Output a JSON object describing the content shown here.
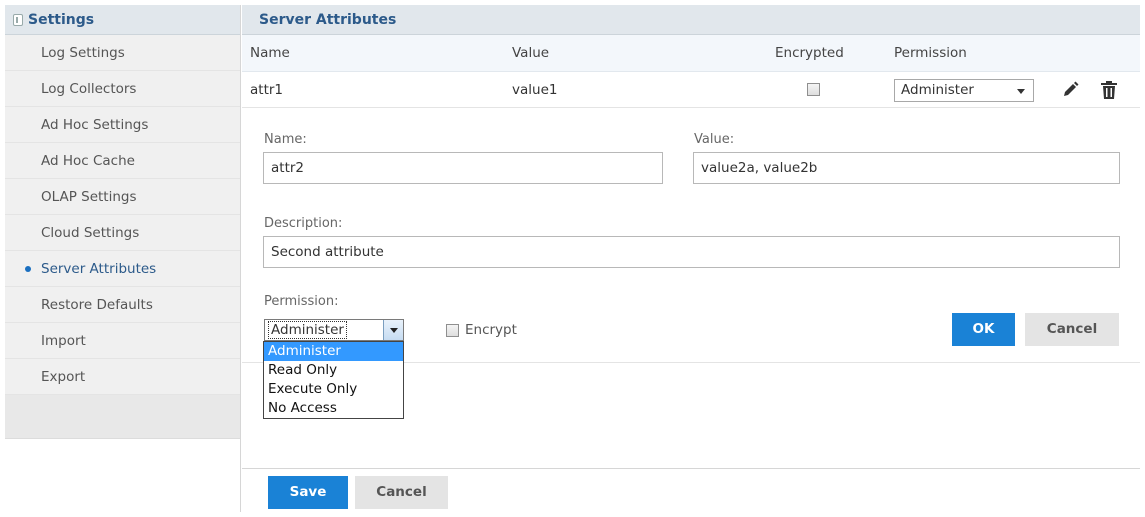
{
  "sidebar": {
    "title": "Settings",
    "items": [
      {
        "label": "Log Settings"
      },
      {
        "label": "Log Collectors"
      },
      {
        "label": "Ad Hoc Settings"
      },
      {
        "label": "Ad Hoc Cache"
      },
      {
        "label": "OLAP Settings"
      },
      {
        "label": "Cloud Settings"
      },
      {
        "label": "Server Attributes"
      },
      {
        "label": "Restore Defaults"
      },
      {
        "label": "Import"
      },
      {
        "label": "Export"
      }
    ]
  },
  "main": {
    "title": "Server Attributes",
    "columns": {
      "name": "Name",
      "value": "Value",
      "encrypted": "Encrypted",
      "permission": "Permission"
    },
    "rows": [
      {
        "name": "attr1",
        "value": "value1",
        "encrypted": false,
        "permission": "Administer"
      }
    ]
  },
  "form": {
    "name_label": "Name:",
    "name_value": "attr2",
    "value_label": "Value:",
    "value_value": "value2a, value2b",
    "description_label": "Description:",
    "description_value": "Second attribute",
    "permission_label": "Permission:",
    "permission_selected": "Administer",
    "permission_options": [
      "Administer",
      "Read Only",
      "Execute Only",
      "No Access"
    ],
    "encrypt_label": "Encrypt",
    "ok_label": "OK",
    "cancel_label": "Cancel"
  },
  "footer": {
    "save_label": "Save",
    "cancel_label": "Cancel"
  },
  "colors": {
    "accent": "#1a82d6",
    "header_text": "#2c5a8a",
    "header_bg": "#e1e7ec"
  }
}
